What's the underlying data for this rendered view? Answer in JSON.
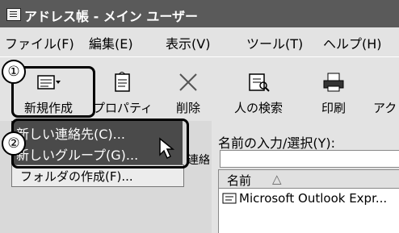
{
  "window": {
    "title": "アドレス帳 - メイン ユーザー"
  },
  "menu": [
    "ファイル(F)",
    "編集(E)",
    "表示(V)",
    "ツール(T)",
    "ヘルプ(H)"
  ],
  "toolbar": {
    "new": "新規作成",
    "properties": "プロパティ",
    "delete": "削除",
    "find_people": "人の検索",
    "print": "印刷",
    "action": "アク"
  },
  "callouts": {
    "one": "①",
    "two": "②"
  },
  "new_dropdown": {
    "items": [
      "新しい連絡先(C)...",
      "新しいグループ(G)..."
    ]
  },
  "submenu": {
    "new_folder": "フォルダの作成(F)..."
  },
  "left_pane": {
    "tab_text": "連絡"
  },
  "right_pane": {
    "search_label": "名前の入力/選択(Y):",
    "column_name": "名前",
    "sort_indicator": "△",
    "rows": [
      "Microsoft Outlook Expr..."
    ]
  },
  "icons": {
    "title": "address-book-icon",
    "new": "new-card-icon",
    "properties": "properties-icon",
    "delete": "delete-x-icon",
    "find_people": "find-people-icon",
    "print": "printer-icon",
    "contact": "contact-card-icon",
    "cursor": "mouse-pointer-icon"
  }
}
